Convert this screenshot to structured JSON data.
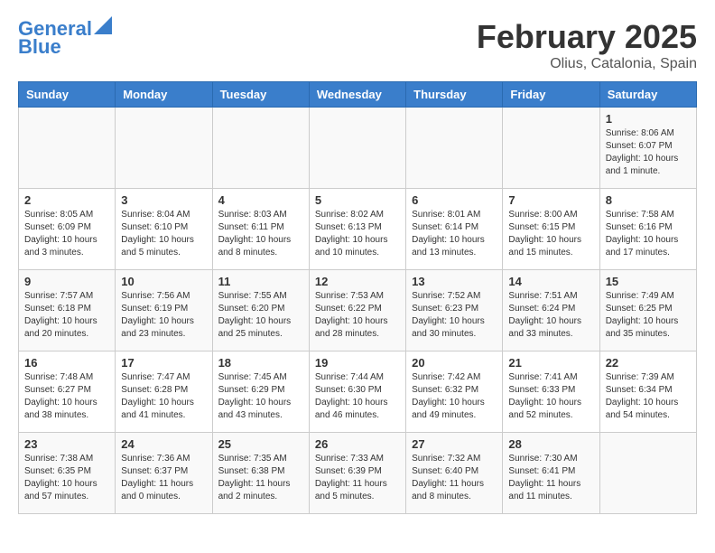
{
  "header": {
    "logo_line1": "General",
    "logo_line2": "Blue",
    "title": "February 2025",
    "subtitle": "Olius, Catalonia, Spain"
  },
  "weekdays": [
    "Sunday",
    "Monday",
    "Tuesday",
    "Wednesday",
    "Thursday",
    "Friday",
    "Saturday"
  ],
  "weeks": [
    [
      {
        "day": "",
        "info": ""
      },
      {
        "day": "",
        "info": ""
      },
      {
        "day": "",
        "info": ""
      },
      {
        "day": "",
        "info": ""
      },
      {
        "day": "",
        "info": ""
      },
      {
        "day": "",
        "info": ""
      },
      {
        "day": "1",
        "info": "Sunrise: 8:06 AM\nSunset: 6:07 PM\nDaylight: 10 hours\nand 1 minute."
      }
    ],
    [
      {
        "day": "2",
        "info": "Sunrise: 8:05 AM\nSunset: 6:09 PM\nDaylight: 10 hours\nand 3 minutes."
      },
      {
        "day": "3",
        "info": "Sunrise: 8:04 AM\nSunset: 6:10 PM\nDaylight: 10 hours\nand 5 minutes."
      },
      {
        "day": "4",
        "info": "Sunrise: 8:03 AM\nSunset: 6:11 PM\nDaylight: 10 hours\nand 8 minutes."
      },
      {
        "day": "5",
        "info": "Sunrise: 8:02 AM\nSunset: 6:13 PM\nDaylight: 10 hours\nand 10 minutes."
      },
      {
        "day": "6",
        "info": "Sunrise: 8:01 AM\nSunset: 6:14 PM\nDaylight: 10 hours\nand 13 minutes."
      },
      {
        "day": "7",
        "info": "Sunrise: 8:00 AM\nSunset: 6:15 PM\nDaylight: 10 hours\nand 15 minutes."
      },
      {
        "day": "8",
        "info": "Sunrise: 7:58 AM\nSunset: 6:16 PM\nDaylight: 10 hours\nand 17 minutes."
      }
    ],
    [
      {
        "day": "9",
        "info": "Sunrise: 7:57 AM\nSunset: 6:18 PM\nDaylight: 10 hours\nand 20 minutes."
      },
      {
        "day": "10",
        "info": "Sunrise: 7:56 AM\nSunset: 6:19 PM\nDaylight: 10 hours\nand 23 minutes."
      },
      {
        "day": "11",
        "info": "Sunrise: 7:55 AM\nSunset: 6:20 PM\nDaylight: 10 hours\nand 25 minutes."
      },
      {
        "day": "12",
        "info": "Sunrise: 7:53 AM\nSunset: 6:22 PM\nDaylight: 10 hours\nand 28 minutes."
      },
      {
        "day": "13",
        "info": "Sunrise: 7:52 AM\nSunset: 6:23 PM\nDaylight: 10 hours\nand 30 minutes."
      },
      {
        "day": "14",
        "info": "Sunrise: 7:51 AM\nSunset: 6:24 PM\nDaylight: 10 hours\nand 33 minutes."
      },
      {
        "day": "15",
        "info": "Sunrise: 7:49 AM\nSunset: 6:25 PM\nDaylight: 10 hours\nand 35 minutes."
      }
    ],
    [
      {
        "day": "16",
        "info": "Sunrise: 7:48 AM\nSunset: 6:27 PM\nDaylight: 10 hours\nand 38 minutes."
      },
      {
        "day": "17",
        "info": "Sunrise: 7:47 AM\nSunset: 6:28 PM\nDaylight: 10 hours\nand 41 minutes."
      },
      {
        "day": "18",
        "info": "Sunrise: 7:45 AM\nSunset: 6:29 PM\nDaylight: 10 hours\nand 43 minutes."
      },
      {
        "day": "19",
        "info": "Sunrise: 7:44 AM\nSunset: 6:30 PM\nDaylight: 10 hours\nand 46 minutes."
      },
      {
        "day": "20",
        "info": "Sunrise: 7:42 AM\nSunset: 6:32 PM\nDaylight: 10 hours\nand 49 minutes."
      },
      {
        "day": "21",
        "info": "Sunrise: 7:41 AM\nSunset: 6:33 PM\nDaylight: 10 hours\nand 52 minutes."
      },
      {
        "day": "22",
        "info": "Sunrise: 7:39 AM\nSunset: 6:34 PM\nDaylight: 10 hours\nand 54 minutes."
      }
    ],
    [
      {
        "day": "23",
        "info": "Sunrise: 7:38 AM\nSunset: 6:35 PM\nDaylight: 10 hours\nand 57 minutes."
      },
      {
        "day": "24",
        "info": "Sunrise: 7:36 AM\nSunset: 6:37 PM\nDaylight: 11 hours\nand 0 minutes."
      },
      {
        "day": "25",
        "info": "Sunrise: 7:35 AM\nSunset: 6:38 PM\nDaylight: 11 hours\nand 2 minutes."
      },
      {
        "day": "26",
        "info": "Sunrise: 7:33 AM\nSunset: 6:39 PM\nDaylight: 11 hours\nand 5 minutes."
      },
      {
        "day": "27",
        "info": "Sunrise: 7:32 AM\nSunset: 6:40 PM\nDaylight: 11 hours\nand 8 minutes."
      },
      {
        "day": "28",
        "info": "Sunrise: 7:30 AM\nSunset: 6:41 PM\nDaylight: 11 hours\nand 11 minutes."
      },
      {
        "day": "",
        "info": ""
      }
    ]
  ]
}
